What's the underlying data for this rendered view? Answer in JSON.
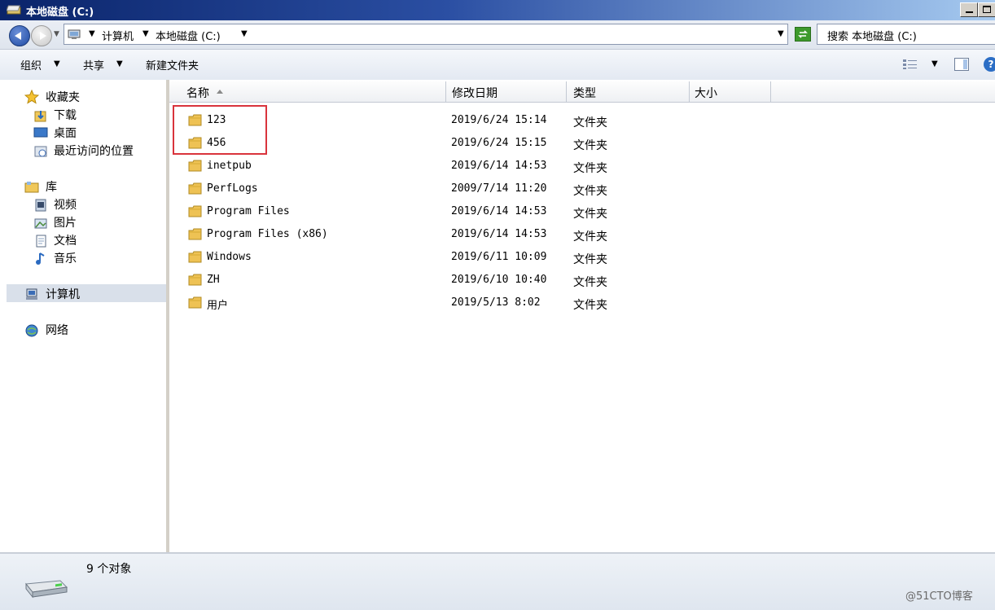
{
  "window": {
    "title": "本地磁盘 (C:)"
  },
  "address": {
    "crumbs": [
      "计算机",
      "本地磁盘 (C:)"
    ],
    "search_placeholder": "搜索 本地磁盘 (C:)"
  },
  "toolbar": {
    "organize": "组织",
    "share": "共享",
    "new_folder": "新建文件夹"
  },
  "nav": {
    "favorites": "收藏夹",
    "downloads": "下载",
    "desktop": "桌面",
    "recent": "最近访问的位置",
    "libraries": "库",
    "videos": "视频",
    "pictures": "图片",
    "documents": "文档",
    "music": "音乐",
    "computer": "计算机",
    "network": "网络"
  },
  "columns": {
    "name": "名称",
    "date": "修改日期",
    "type": "类型",
    "size": "大小"
  },
  "files": [
    {
      "name": "123",
      "date": "2019/6/24 15:14",
      "type": "文件夹"
    },
    {
      "name": "456",
      "date": "2019/6/24 15:15",
      "type": "文件夹"
    },
    {
      "name": "inetpub",
      "date": "2019/6/14 14:53",
      "type": "文件夹"
    },
    {
      "name": "PerfLogs",
      "date": "2009/7/14 11:20",
      "type": "文件夹"
    },
    {
      "name": "Program Files",
      "date": "2019/6/14 14:53",
      "type": "文件夹"
    },
    {
      "name": "Program Files (x86)",
      "date": "2019/6/14 14:53",
      "type": "文件夹"
    },
    {
      "name": "Windows",
      "date": "2019/6/11 10:09",
      "type": "文件夹"
    },
    {
      "name": "ZH",
      "date": "2019/6/10 10:40",
      "type": "文件夹"
    },
    {
      "name": "用户",
      "date": "2019/5/13 8:02",
      "type": "文件夹"
    }
  ],
  "status": {
    "count": "9 个对象"
  },
  "watermark": "@51CTO博客"
}
